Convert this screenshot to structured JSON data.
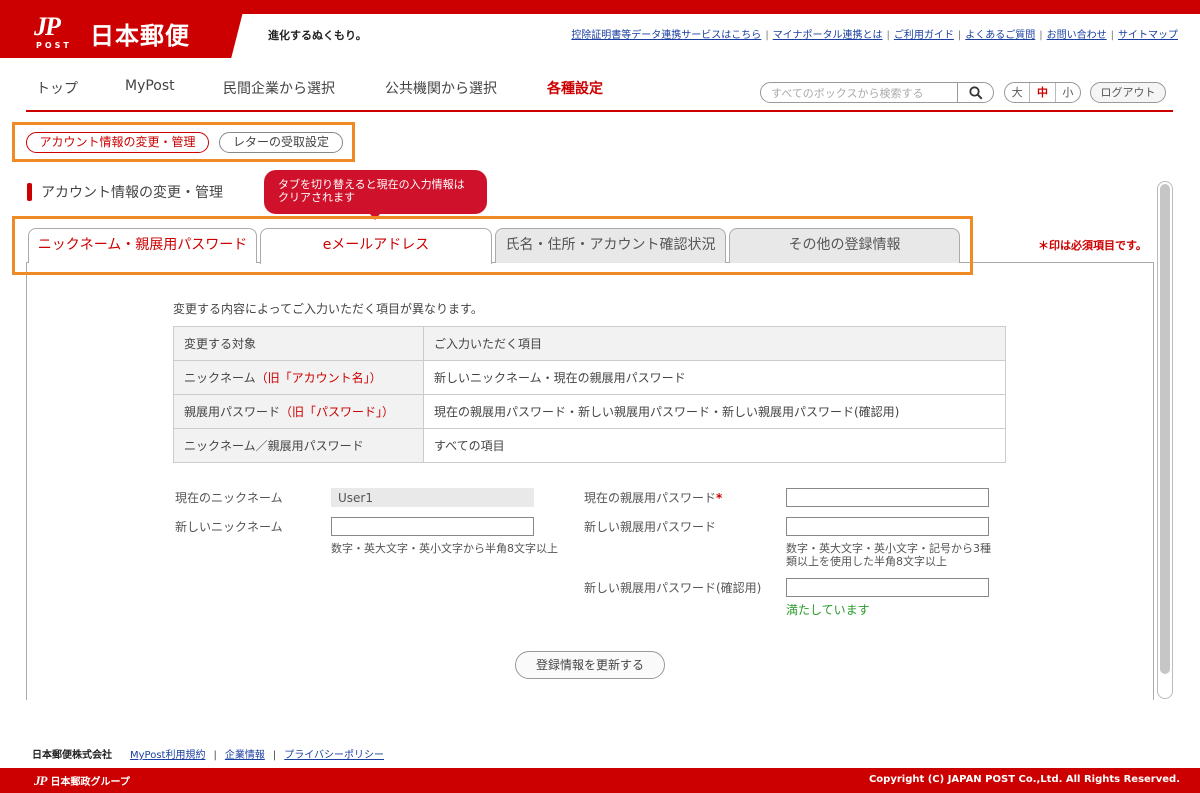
{
  "header": {
    "logo_mark": "JP",
    "logo_post": "POST",
    "logo_name": "日本郵便",
    "tagline": "進化するぬくもり。",
    "util_links": [
      "控除証明書等データ連携サービスはこちら",
      "マイナポータル連携とは",
      "ご利用ガイド",
      "よくあるご質問",
      "お問い合わせ",
      "サイトマップ"
    ]
  },
  "nav": {
    "items": [
      "トップ",
      "MyPost",
      "民間企業から選択",
      "公共機関から選択",
      "各種設定"
    ],
    "active_index": 4,
    "search_placeholder": "すべてのボックスから検索する",
    "font_sizes": [
      "大",
      "中",
      "小"
    ],
    "font_size_active": "中",
    "logout_label": "ログアウト"
  },
  "subnav": {
    "items": [
      "アカウント情報の変更・管理",
      "レターの受取設定"
    ],
    "active_index": 0
  },
  "section_title": "アカウント情報の変更・管理",
  "tooltip": "タブを切り替えると現在の入力情報はクリアされます",
  "tabs": [
    "ニックネーム・親展用パスワード",
    "eメールアドレス",
    "氏名・住所・アカウント確認状況",
    "その他の登録情報"
  ],
  "required_note": "＊印は必須項目です。",
  "intro": "変更する内容によってご入力いただく項目が異なります。",
  "table": {
    "headers": [
      "変更する対象",
      "ご入力いただく項目"
    ],
    "rows": [
      {
        "target": "ニックネーム",
        "note": "（旧「アカウント名」）",
        "items": "新しいニックネーム・現在の親展用パスワード"
      },
      {
        "target": "親展用パスワード",
        "note": "（旧「パスワード」）",
        "items": "現在の親展用パスワード・新しい親展用パスワード・新しい親展用パスワード(確認用)"
      },
      {
        "target": "ニックネーム／親展用パスワード",
        "note": "",
        "items": "すべての項目"
      }
    ]
  },
  "form": {
    "current_nickname_label": "現在のニックネーム",
    "current_nickname_value": "User1",
    "new_nickname_label": "新しいニックネーム",
    "new_nickname_value": "",
    "new_nickname_hint": "数字・英大文字・英小文字から半角8文字以上",
    "current_password_label": "現在の親展用パスワード",
    "required_mark": "*",
    "current_password_value": "",
    "new_password_label": "新しい親展用パスワード",
    "new_password_value": "",
    "new_password_hint_1": "数字・英大文字・英小文字・記号から3種",
    "new_password_hint_2": "類以上を使用した半角8文字以上",
    "confirm_password_label": "新しい親展用パスワード(確認用)",
    "confirm_password_value": "",
    "confirm_status": "満たしています",
    "submit_label": "登録情報を更新する"
  },
  "footer": {
    "company": "日本郵便株式会社",
    "links": [
      "MyPost利用規約",
      "企業情報",
      "プライバシーポリシー"
    ],
    "group_mark": "JP",
    "group_name": "日本郵政グループ",
    "copyright": "Copyright (C) JAPAN POST Co.,Ltd. All Rights Reserved."
  },
  "colors": {
    "brand_red": "#cc0000",
    "highlight_orange": "#f08a24",
    "tooltip_red": "#d0112b",
    "ok_green": "#2a9b2a",
    "link_blue": "#1a3fa0"
  }
}
